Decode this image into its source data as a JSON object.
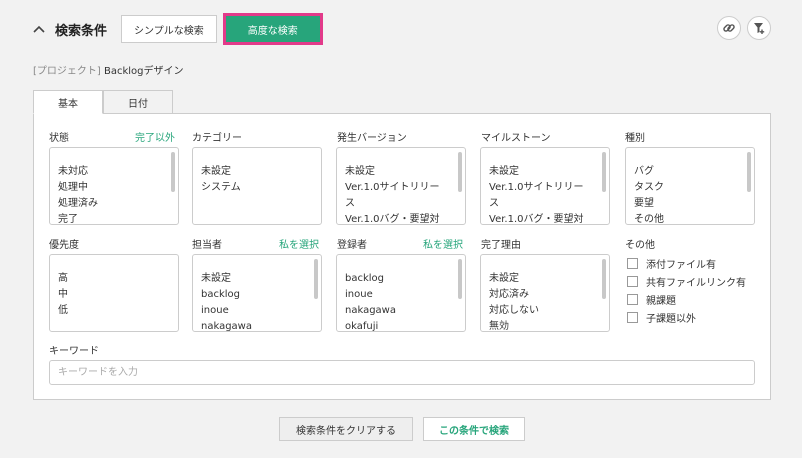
{
  "header": {
    "title": "検索条件",
    "simple_label": "シンプルな検索",
    "advanced_label": "高度な検索"
  },
  "project": {
    "prefix": "[プロジェクト]",
    "name": "Backlogデザイン"
  },
  "tabs": [
    {
      "label": "基本"
    },
    {
      "label": "日付"
    }
  ],
  "fields": {
    "status": {
      "label": "状態",
      "link": "完了以外",
      "items": [
        "未対応",
        "処理中",
        "処理済み",
        "完了"
      ]
    },
    "category": {
      "label": "カテゴリー",
      "items": [
        "未設定",
        "システム"
      ]
    },
    "version": {
      "label": "発生バージョン",
      "items": [
        "未設定",
        "Ver.1.0サイトリリー",
        "ス",
        "Ver.1.0バグ・要望対"
      ]
    },
    "milestone": {
      "label": "マイルストーン",
      "items": [
        "未設定",
        "Ver.1.0サイトリリー",
        "ス",
        "Ver.1.0バグ・要望対"
      ]
    },
    "type": {
      "label": "種別",
      "items": [
        "バグ",
        "タスク",
        "要望",
        "その他"
      ]
    },
    "priority": {
      "label": "優先度",
      "items": [
        "高",
        "中",
        "低"
      ]
    },
    "assignee": {
      "label": "担当者",
      "link": "私を選択",
      "items": [
        "未設定",
        "backlog",
        "inoue",
        "nakagawa"
      ]
    },
    "registrant": {
      "label": "登録者",
      "link": "私を選択",
      "items": [
        "backlog",
        "inoue",
        "nakagawa",
        "okafuji"
      ]
    },
    "resolution": {
      "label": "完了理由",
      "items": [
        "未設定",
        "対応済み",
        "対応しない",
        "無効"
      ]
    },
    "other": {
      "label": "その他",
      "options": [
        "添付ファイル有",
        "共有ファイルリンク有",
        "親課題",
        "子課題以外"
      ]
    },
    "keyword": {
      "label": "キーワード",
      "placeholder": "キーワードを入力"
    }
  },
  "footer": {
    "clear_label": "検索条件をクリアする",
    "search_label": "この条件で検索"
  },
  "colors": {
    "accent": "#27a57b",
    "highlight": "#e23a8a"
  }
}
